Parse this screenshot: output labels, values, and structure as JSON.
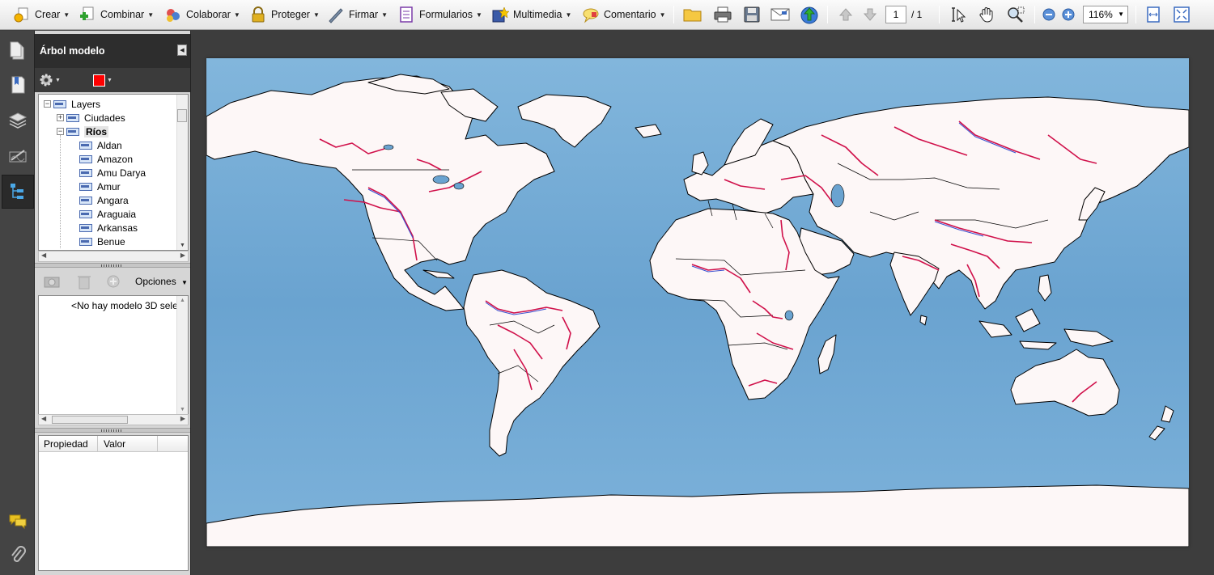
{
  "toolbar": {
    "crear": "Crear",
    "combinar": "Combinar",
    "colaborar": "Colaborar",
    "proteger": "Proteger",
    "firmar": "Firmar",
    "formularios": "Formularios",
    "multimedia": "Multimedia",
    "comentario": "Comentario",
    "page_current": "1",
    "page_total": "/ 1",
    "zoom": "116%"
  },
  "panel": {
    "title": "Árbol modelo",
    "options_label": "Opciones",
    "no_model_msg": "<No hay modelo 3D sele",
    "swatch_color": "#ff0000",
    "property_col": "Propiedad",
    "value_col": "Valor"
  },
  "tree": {
    "root": "Layers",
    "group1": "Ciudades",
    "group2": "Ríos",
    "rivers": [
      "Aldan",
      "Amazon",
      "Amu Darya",
      "Amur",
      "Angara",
      "Araguaia",
      "Arkansas",
      "Benue"
    ]
  },
  "colors": {
    "ocean": "#6fa8d4",
    "land": "#fdf7f7",
    "river_red": "#d0104a",
    "river_blue": "#3a4fd0"
  }
}
